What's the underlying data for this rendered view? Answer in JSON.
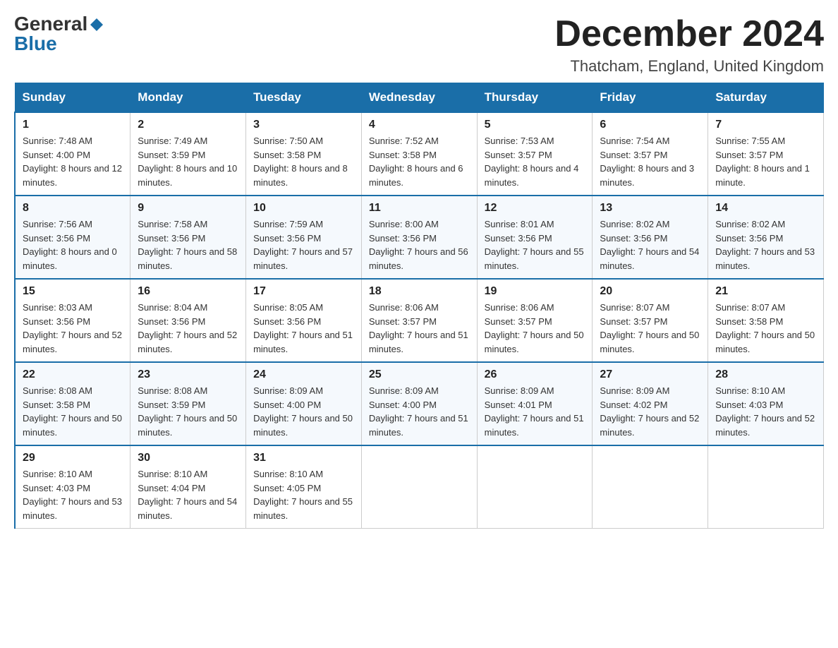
{
  "header": {
    "logo_general": "General",
    "logo_blue": "Blue",
    "month_title": "December 2024",
    "location": "Thatcham, England, United Kingdom"
  },
  "columns": [
    "Sunday",
    "Monday",
    "Tuesday",
    "Wednesday",
    "Thursday",
    "Friday",
    "Saturday"
  ],
  "weeks": [
    [
      {
        "day": "1",
        "sunrise": "7:48 AM",
        "sunset": "4:00 PM",
        "daylight": "8 hours and 12 minutes."
      },
      {
        "day": "2",
        "sunrise": "7:49 AM",
        "sunset": "3:59 PM",
        "daylight": "8 hours and 10 minutes."
      },
      {
        "day": "3",
        "sunrise": "7:50 AM",
        "sunset": "3:58 PM",
        "daylight": "8 hours and 8 minutes."
      },
      {
        "day": "4",
        "sunrise": "7:52 AM",
        "sunset": "3:58 PM",
        "daylight": "8 hours and 6 minutes."
      },
      {
        "day": "5",
        "sunrise": "7:53 AM",
        "sunset": "3:57 PM",
        "daylight": "8 hours and 4 minutes."
      },
      {
        "day": "6",
        "sunrise": "7:54 AM",
        "sunset": "3:57 PM",
        "daylight": "8 hours and 3 minutes."
      },
      {
        "day": "7",
        "sunrise": "7:55 AM",
        "sunset": "3:57 PM",
        "daylight": "8 hours and 1 minute."
      }
    ],
    [
      {
        "day": "8",
        "sunrise": "7:56 AM",
        "sunset": "3:56 PM",
        "daylight": "8 hours and 0 minutes."
      },
      {
        "day": "9",
        "sunrise": "7:58 AM",
        "sunset": "3:56 PM",
        "daylight": "7 hours and 58 minutes."
      },
      {
        "day": "10",
        "sunrise": "7:59 AM",
        "sunset": "3:56 PM",
        "daylight": "7 hours and 57 minutes."
      },
      {
        "day": "11",
        "sunrise": "8:00 AM",
        "sunset": "3:56 PM",
        "daylight": "7 hours and 56 minutes."
      },
      {
        "day": "12",
        "sunrise": "8:01 AM",
        "sunset": "3:56 PM",
        "daylight": "7 hours and 55 minutes."
      },
      {
        "day": "13",
        "sunrise": "8:02 AM",
        "sunset": "3:56 PM",
        "daylight": "7 hours and 54 minutes."
      },
      {
        "day": "14",
        "sunrise": "8:02 AM",
        "sunset": "3:56 PM",
        "daylight": "7 hours and 53 minutes."
      }
    ],
    [
      {
        "day": "15",
        "sunrise": "8:03 AM",
        "sunset": "3:56 PM",
        "daylight": "7 hours and 52 minutes."
      },
      {
        "day": "16",
        "sunrise": "8:04 AM",
        "sunset": "3:56 PM",
        "daylight": "7 hours and 52 minutes."
      },
      {
        "day": "17",
        "sunrise": "8:05 AM",
        "sunset": "3:56 PM",
        "daylight": "7 hours and 51 minutes."
      },
      {
        "day": "18",
        "sunrise": "8:06 AM",
        "sunset": "3:57 PM",
        "daylight": "7 hours and 51 minutes."
      },
      {
        "day": "19",
        "sunrise": "8:06 AM",
        "sunset": "3:57 PM",
        "daylight": "7 hours and 50 minutes."
      },
      {
        "day": "20",
        "sunrise": "8:07 AM",
        "sunset": "3:57 PM",
        "daylight": "7 hours and 50 minutes."
      },
      {
        "day": "21",
        "sunrise": "8:07 AM",
        "sunset": "3:58 PM",
        "daylight": "7 hours and 50 minutes."
      }
    ],
    [
      {
        "day": "22",
        "sunrise": "8:08 AM",
        "sunset": "3:58 PM",
        "daylight": "7 hours and 50 minutes."
      },
      {
        "day": "23",
        "sunrise": "8:08 AM",
        "sunset": "3:59 PM",
        "daylight": "7 hours and 50 minutes."
      },
      {
        "day": "24",
        "sunrise": "8:09 AM",
        "sunset": "4:00 PM",
        "daylight": "7 hours and 50 minutes."
      },
      {
        "day": "25",
        "sunrise": "8:09 AM",
        "sunset": "4:00 PM",
        "daylight": "7 hours and 51 minutes."
      },
      {
        "day": "26",
        "sunrise": "8:09 AM",
        "sunset": "4:01 PM",
        "daylight": "7 hours and 51 minutes."
      },
      {
        "day": "27",
        "sunrise": "8:09 AM",
        "sunset": "4:02 PM",
        "daylight": "7 hours and 52 minutes."
      },
      {
        "day": "28",
        "sunrise": "8:10 AM",
        "sunset": "4:03 PM",
        "daylight": "7 hours and 52 minutes."
      }
    ],
    [
      {
        "day": "29",
        "sunrise": "8:10 AM",
        "sunset": "4:03 PM",
        "daylight": "7 hours and 53 minutes."
      },
      {
        "day": "30",
        "sunrise": "8:10 AM",
        "sunset": "4:04 PM",
        "daylight": "7 hours and 54 minutes."
      },
      {
        "day": "31",
        "sunrise": "8:10 AM",
        "sunset": "4:05 PM",
        "daylight": "7 hours and 55 minutes."
      },
      null,
      null,
      null,
      null
    ]
  ]
}
